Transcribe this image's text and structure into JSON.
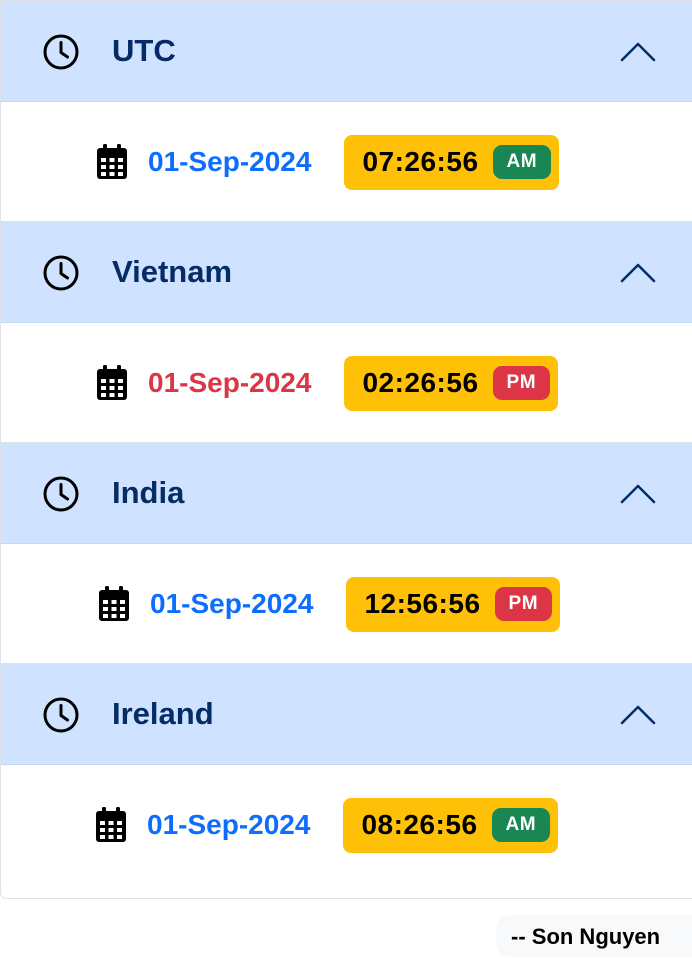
{
  "zones": [
    {
      "name": "UTC",
      "date": "01-Sep-2024",
      "date_color": "blue",
      "time": "07:26:56",
      "period": "AM",
      "period_color": "green",
      "expanded": true
    },
    {
      "name": "Vietnam",
      "date": "01-Sep-2024",
      "date_color": "red",
      "time": "02:26:56",
      "period": "PM",
      "period_color": "red",
      "expanded": true
    },
    {
      "name": "India",
      "date": "01-Sep-2024",
      "date_color": "blue",
      "time": "12:56:56",
      "period": "PM",
      "period_color": "red",
      "expanded": true
    },
    {
      "name": "Ireland",
      "date": "01-Sep-2024",
      "date_color": "blue",
      "time": "08:26:56",
      "period": "AM",
      "period_color": "green",
      "expanded": true
    }
  ],
  "signature": "-- Son Nguyen",
  "icons": {
    "header": "clock-icon",
    "toggle": "chevron-up-icon",
    "date": "calendar-icon"
  },
  "colors": {
    "header_bg": "#cfe2ff",
    "header_text": "#052c65",
    "date_blue": "#0d6efd",
    "date_red": "#dc3545",
    "time_badge": "#ffc107",
    "am_badge": "#198754",
    "pm_badge": "#dc3545"
  }
}
